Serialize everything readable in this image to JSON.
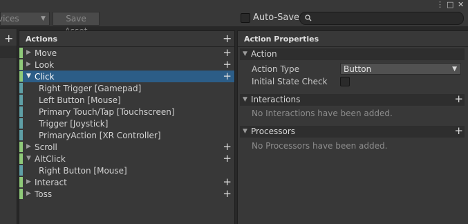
{
  "toolbar": {
    "devices_label": "vices",
    "save_asset_label": "Save Asset",
    "auto_save_label": "Auto-Save",
    "auto_save_checked": false,
    "search_value": ""
  },
  "window_controls": {
    "menu": "⋮",
    "maximize": "□",
    "close": "✕"
  },
  "left_panel": {
    "add": "+"
  },
  "actions_panel": {
    "title": "Actions",
    "add": "+",
    "rows": [
      {
        "kind": "action",
        "label": "Move",
        "expanded": false,
        "selected": false
      },
      {
        "kind": "action",
        "label": "Look",
        "expanded": false,
        "selected": false
      },
      {
        "kind": "action",
        "label": "Click",
        "expanded": true,
        "selected": true
      },
      {
        "kind": "binding",
        "label": "Right Trigger [Gamepad]"
      },
      {
        "kind": "binding",
        "label": "Left Button [Mouse]"
      },
      {
        "kind": "binding",
        "label": "Primary Touch/Tap [Touchscreen]"
      },
      {
        "kind": "binding",
        "label": "Trigger [Joystick]"
      },
      {
        "kind": "binding",
        "label": "PrimaryAction [XR Controller]"
      },
      {
        "kind": "action",
        "label": "Scroll",
        "expanded": false,
        "selected": false
      },
      {
        "kind": "action",
        "label": "AltClick",
        "expanded": true,
        "selected": false
      },
      {
        "kind": "binding",
        "label": "Right Button [Mouse]"
      },
      {
        "kind": "action",
        "label": "Interact",
        "expanded": false,
        "selected": false
      },
      {
        "kind": "action",
        "label": "Toss",
        "expanded": false,
        "selected": false
      }
    ]
  },
  "properties_panel": {
    "title": "Action Properties",
    "action_section": {
      "title": "Action",
      "action_type_label": "Action Type",
      "action_type_value": "Button",
      "initial_state_label": "Initial State Check",
      "initial_state_checked": false
    },
    "interactions": {
      "title": "Interactions",
      "empty": "No Interactions have been added."
    },
    "processors": {
      "title": "Processors",
      "empty": "No Processors have been added."
    }
  },
  "colors": {
    "action_bar": "#8fca7a",
    "binding_bar": "#5f9fa6",
    "selection": "#2c5d87"
  }
}
